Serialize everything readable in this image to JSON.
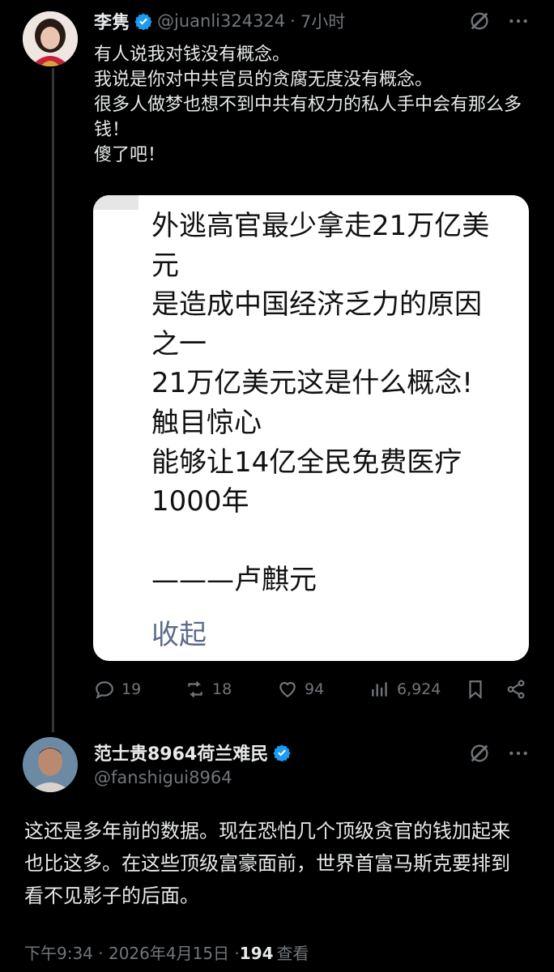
{
  "tweet1": {
    "author_name": "李隽",
    "handle": "@juanli324324",
    "separator": "·",
    "time": "7小时",
    "text": "有人说我对钱没有概念。\n我说是你对中共官员的贪腐无度没有概念。\n很多人做梦也想不到中共有权力的私人手中会有那么多钱！\n傻了吧！",
    "image_card": {
      "text": "外逃高官最少拿走21万亿美元\n是造成中国经济乏力的原因之一\n21万亿美元这是什么概念!触目惊心\n能够让14亿全民免费医疗1000年\n\n———卢麒元",
      "collapse_label": "收起"
    },
    "actions": {
      "replies": "19",
      "reposts": "18",
      "likes": "94",
      "views": "6,924"
    }
  },
  "tweet2": {
    "author_name": "范士贵8964荷兰难民",
    "handle": "@fanshigui8964",
    "text": "这还是多年前的数据。现在恐怕几个顶级贪官的钱加起来也比这多。在这些顶级富豪面前，世界首富马斯克要排到看不见影子的后面。",
    "timestamp": "下午9:34 · 2026年4月15日 · ",
    "view_count": "194",
    "view_label": "查看"
  },
  "colors": {
    "background": "#000000",
    "text": "#e7e9ea",
    "muted": "#71767b",
    "verified": "#1d9bf0",
    "card": "#ffffff"
  },
  "icons": [
    "verified-badge-icon",
    "grok-icon",
    "more-icon",
    "reply-icon",
    "repost-icon",
    "like-icon",
    "views-icon",
    "bookmark-icon",
    "share-icon"
  ]
}
